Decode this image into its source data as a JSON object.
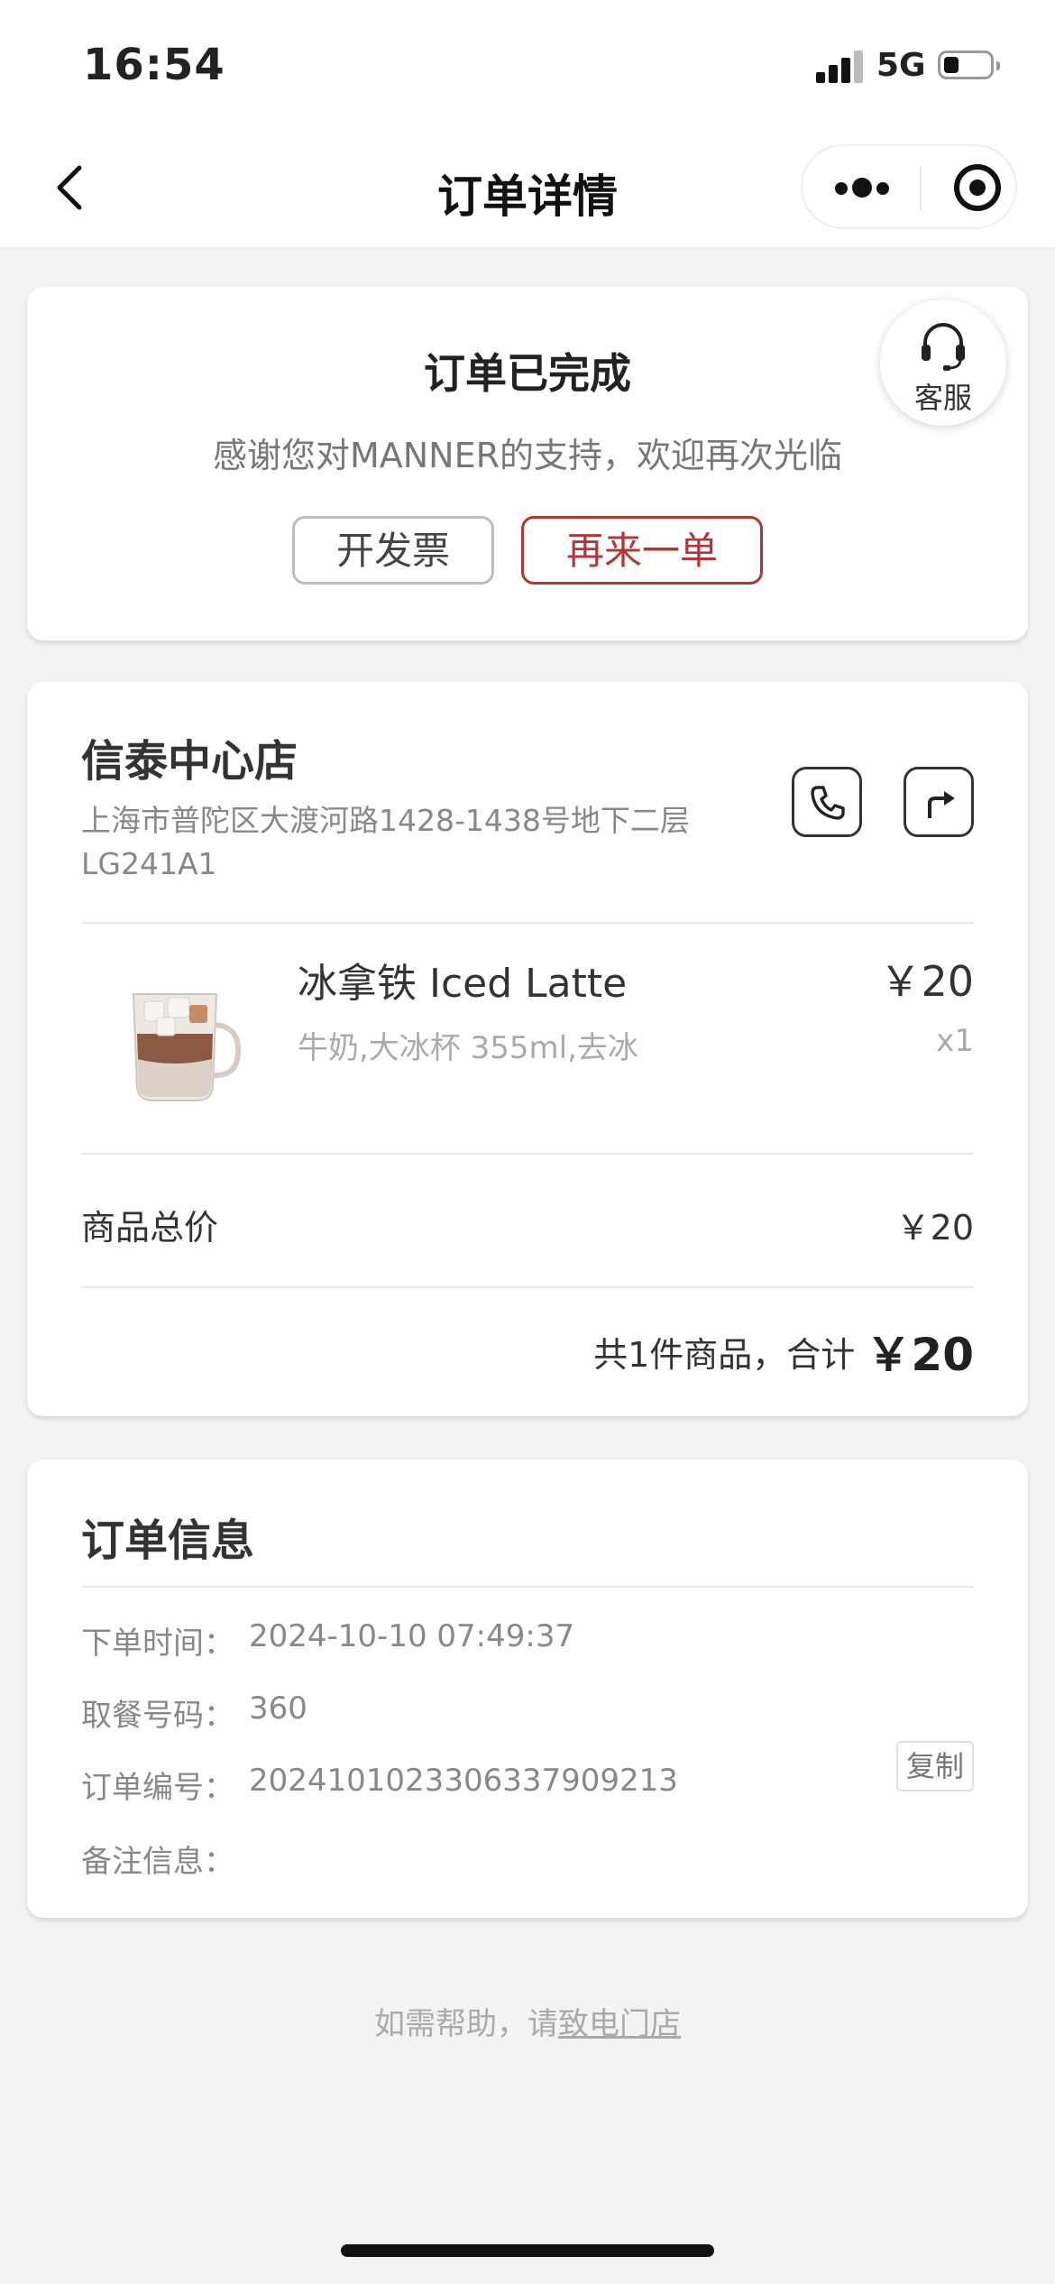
{
  "status_bar": {
    "time": "16:54",
    "network": "5G"
  },
  "nav": {
    "title": "订单详情"
  },
  "order_status": {
    "title": "订单已完成",
    "message": "感谢您对MANNER的支持，欢迎再次光临",
    "invoice_label": "开发票",
    "reorder_label": "再来一单",
    "service_label": "客服"
  },
  "store": {
    "name": "信泰中心店",
    "address": "上海市普陀区大渡河路1428-1438号地下二层LG241A1"
  },
  "items": [
    {
      "name": "冰拿铁 Iced Latte",
      "spec": "牛奶,大冰杯 355ml,去冰",
      "price": "￥20",
      "quantity": "x1"
    }
  ],
  "totals": {
    "subtotal_label": "商品总价",
    "subtotal_value": "￥20",
    "summary_prefix": "共1件商品，合计",
    "summary_total": "￥20"
  },
  "order_info": {
    "title": "订单信息",
    "rows": [
      {
        "label": "下单时间：",
        "value": "2024-10-10 07:49:37"
      },
      {
        "label": "取餐号码：",
        "value": "360"
      },
      {
        "label": "订单编号：",
        "value": "2024101023306337909213"
      },
      {
        "label": "备注信息：",
        "value": ""
      }
    ],
    "copy_label": "复制"
  },
  "help": {
    "prefix": "如需帮助，请",
    "link": "致电门店"
  },
  "colors": {
    "accent": "#b83434",
    "background": "#f3f3f3",
    "card": "#ffffff"
  }
}
